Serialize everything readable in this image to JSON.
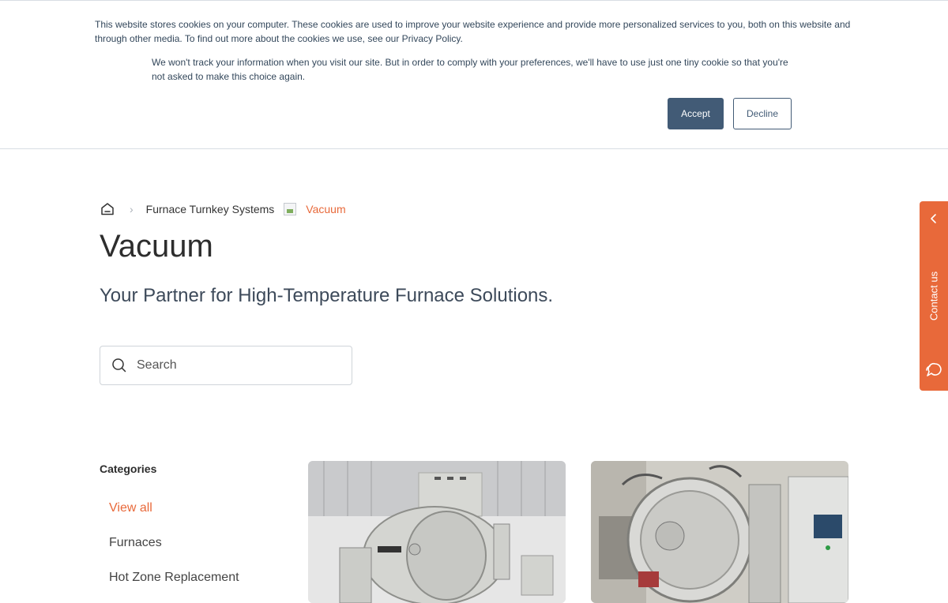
{
  "cookie_banner": {
    "text_primary": "This website stores cookies on your computer. These cookies are used to improve your website experience and provide more personalized services to you, both on this website and through other media. To find out more about the cookies we use, see our Privacy Policy.",
    "text_secondary": "We won't track your information when you visit our site. But in order to comply with your preferences, we'll have to use just one tiny cookie so that you're not asked to make this choice again.",
    "accept_label": "Accept",
    "decline_label": "Decline"
  },
  "breadcrumb": {
    "home_icon": "home-icon",
    "separator": "›",
    "parent": "Furnace Turnkey Systems",
    "current": "Vacuum"
  },
  "page": {
    "title": "Vacuum",
    "subtitle": "Your Partner for High-Temperature Furnace Solutions."
  },
  "search": {
    "placeholder": "Search",
    "icon": "search-icon"
  },
  "categories": {
    "heading": "Categories",
    "items": [
      {
        "label": "View all",
        "active": true
      },
      {
        "label": "Furnaces",
        "active": false
      },
      {
        "label": "Hot Zone Replacement",
        "active": false
      }
    ]
  },
  "cards": [
    {
      "image": "vacuum-furnace-warehouse-image"
    },
    {
      "image": "vacuum-furnace-open-door-image"
    }
  ],
  "contact_tab": {
    "label": "Contact us",
    "chevron_icon": "chevron-left-icon",
    "chat_icon": "chat-icon"
  },
  "colors": {
    "accent": "#e8693a",
    "banner_button": "#425b76",
    "text_dark": "#2d2d2d"
  }
}
